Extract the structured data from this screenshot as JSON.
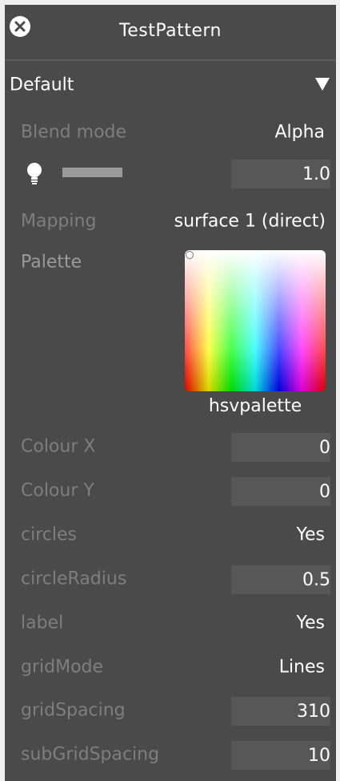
{
  "panel": {
    "title": "TestPattern",
    "close_icon": "close-circle-icon"
  },
  "preset": {
    "label": "Default",
    "dropdown_icon": "triangle-down-icon"
  },
  "blend_mode": {
    "label": "Blend mode",
    "value": "Alpha"
  },
  "opacity": {
    "icon": "lightbulb-icon",
    "value": "1.0"
  },
  "mapping": {
    "label": "Mapping",
    "value": "surface 1 (direct)"
  },
  "palette": {
    "label": "Palette",
    "name": "hsvpalette"
  },
  "colour_x": {
    "label": "Colour X",
    "value": "0"
  },
  "colour_y": {
    "label": "Colour Y",
    "value": "0"
  },
  "circles": {
    "label": "circles",
    "value": "Yes"
  },
  "circle_radius": {
    "label": "circleRadius",
    "value": "0.5"
  },
  "label_param": {
    "label": "label",
    "value": "Yes"
  },
  "grid_mode": {
    "label": "gridMode",
    "value": "Lines"
  },
  "grid_spacing": {
    "label": "gridSpacing",
    "value": "310"
  },
  "sub_grid_spacing": {
    "label": "subGridSpacing",
    "value": "10"
  },
  "colors": {
    "panel_bg": "#4a4a4a",
    "page_bg": "#efefef",
    "label_text": "#7e7e7e",
    "value_text": "#ffffff",
    "field_bg": "#575757"
  }
}
